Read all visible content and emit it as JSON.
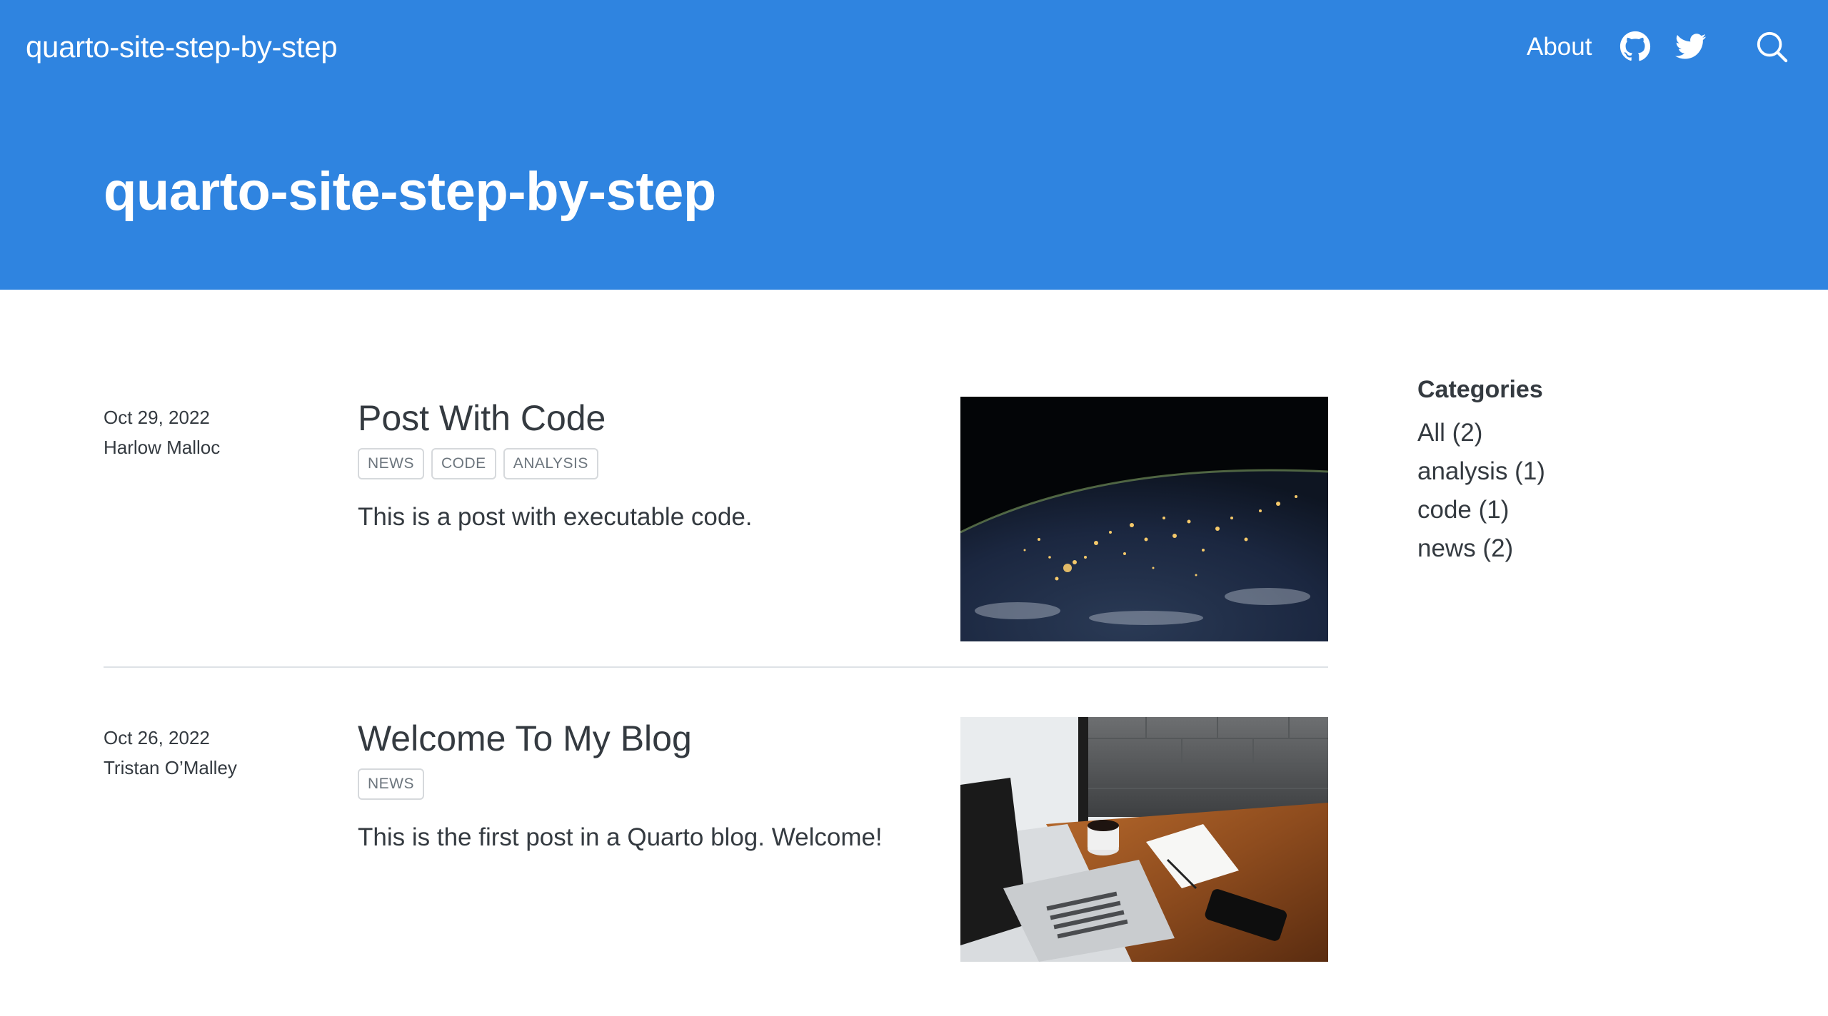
{
  "navbar": {
    "brand": "quarto-site-step-by-step",
    "about_label": "About",
    "icons": [
      "github-icon",
      "twitter-icon",
      "search-icon"
    ],
    "background_color": "#2f84e0"
  },
  "hero": {
    "title": "quarto-site-step-by-step"
  },
  "posts": [
    {
      "date": "Oct 29, 2022",
      "author": "Harlow Malloc",
      "title": "Post With Code",
      "tags": [
        "NEWS",
        "CODE",
        "ANALYSIS"
      ],
      "description": "This is a post with executable code."
    },
    {
      "date": "Oct 26, 2022",
      "author": "Tristan O’Malley",
      "title": "Welcome To My Blog",
      "tags": [
        "NEWS"
      ],
      "description": "This is the first post in a Quarto blog. Welcome!"
    }
  ],
  "categories": {
    "heading": "Categories",
    "items": [
      "All (2)",
      "analysis (1)",
      "code (1)",
      "news (2)"
    ]
  }
}
